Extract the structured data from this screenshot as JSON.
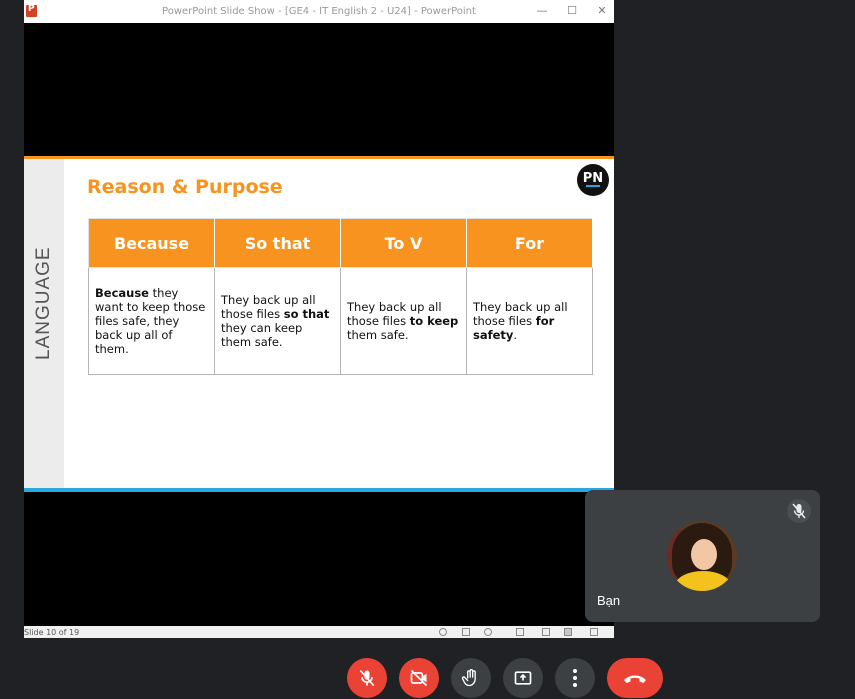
{
  "window": {
    "title": "PowerPoint Slide Show - [GE4 - IT English 2 - U24] - PowerPoint",
    "minimize": "—",
    "maximize": "☐",
    "close": "✕"
  },
  "slide": {
    "side_label": "LANGUAGE",
    "title": "Reason & Purpose",
    "logo_text": "PN",
    "table": {
      "headers": [
        "Because",
        "So that",
        "To V",
        "For"
      ],
      "cells": [
        {
          "bold": "Because",
          "rest": " they want to keep those files safe, they back up all of them."
        },
        {
          "pre": "They back up all those files ",
          "bold": "so that",
          "post": " they can keep them safe."
        },
        {
          "pre": "They back up all those files ",
          "bold": "to keep",
          "post": " them safe."
        },
        {
          "pre": "They back up all those files ",
          "bold": "for safety",
          "post": "."
        }
      ]
    }
  },
  "statusbar": {
    "slide_indicator": "Slide 10 of 19"
  },
  "participant": {
    "name": "Bạn"
  },
  "colors": {
    "accent_orange": "#f7931e",
    "accent_blue": "#29a8e0",
    "meet_red": "#ea4335",
    "meet_gray": "#3c4043"
  },
  "controls": {
    "mic": "mic-off-icon",
    "camera": "camera-off-icon",
    "hand": "raise-hand-icon",
    "present": "present-screen-icon",
    "more": "more-options-icon",
    "leave": "end-call-icon"
  }
}
